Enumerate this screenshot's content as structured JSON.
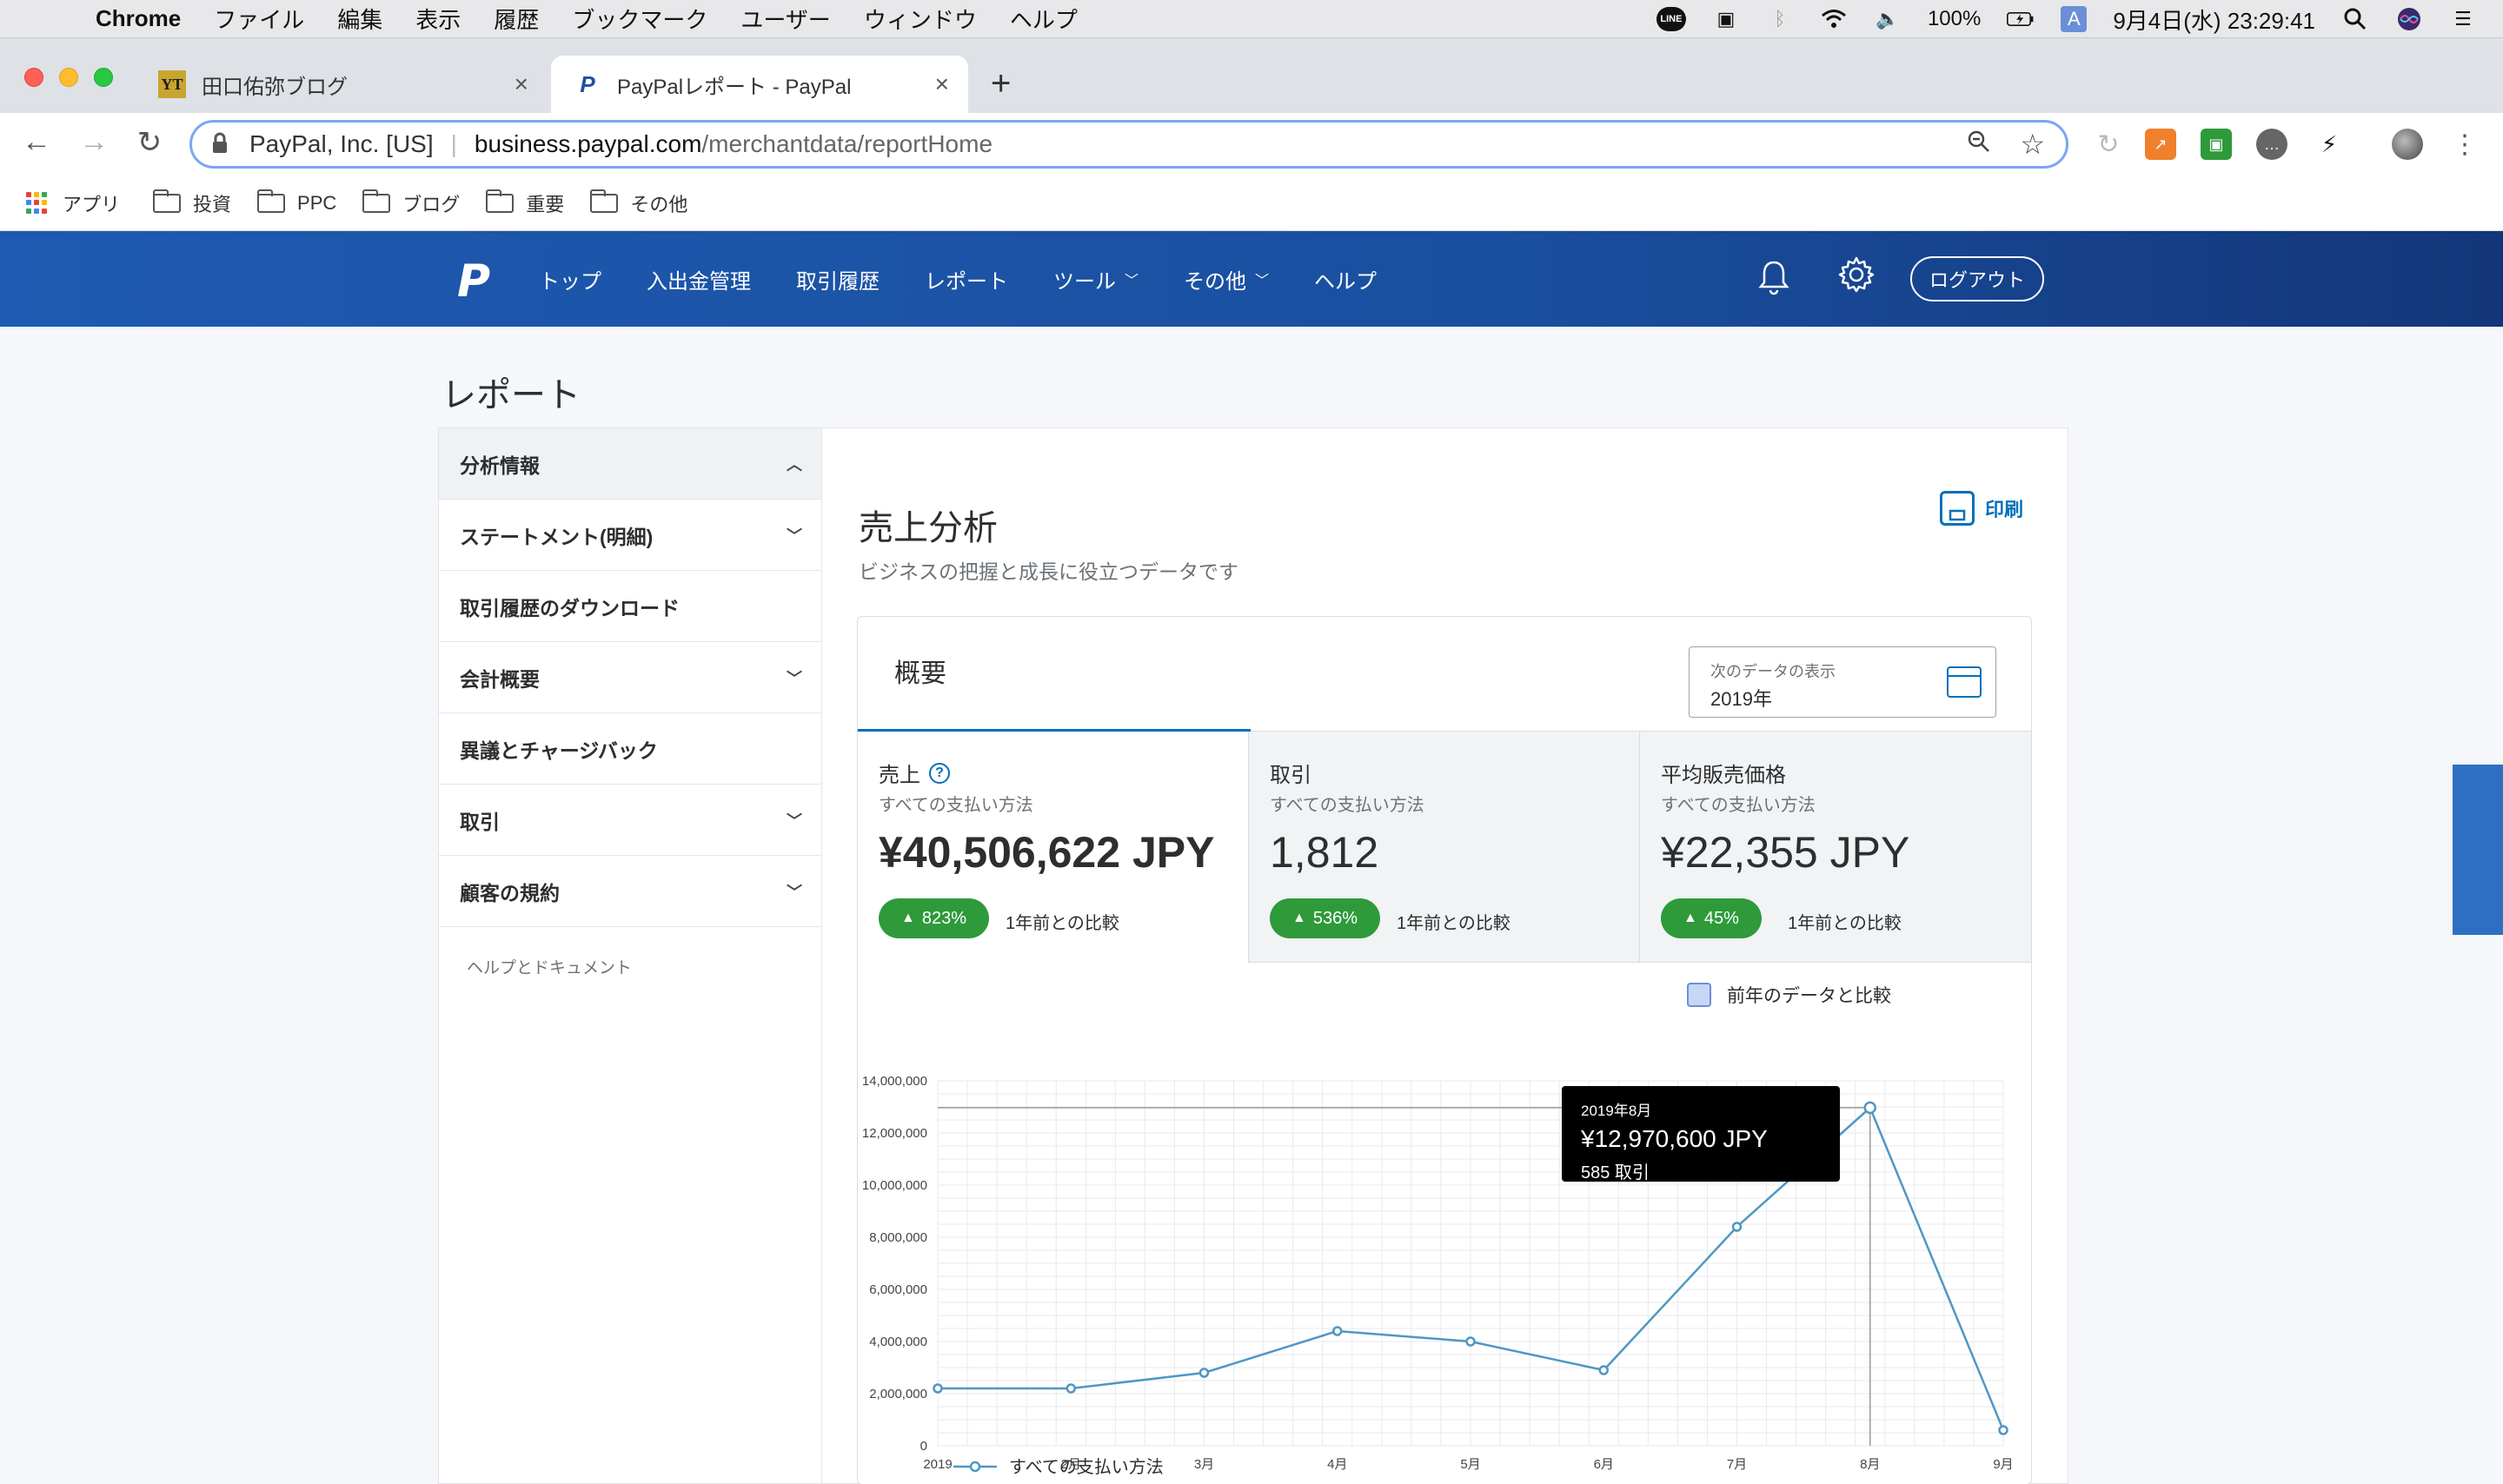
{
  "menubar": {
    "app": "Chrome",
    "items": [
      "ファイル",
      "編集",
      "表示",
      "履歴",
      "ブックマーク",
      "ユーザー",
      "ウィンドウ",
      "ヘルプ"
    ],
    "line_icon": "LINE",
    "battery": "100%",
    "input_method": "A",
    "clock": "9月4日(水)  23:29:41"
  },
  "tabs": [
    {
      "title": "田口佑弥ブログ",
      "favicon": "YT"
    },
    {
      "title": "PayPalレポート - PayPal",
      "favicon": "P"
    }
  ],
  "omnibox": {
    "org": "PayPal, Inc. [US]",
    "host": "business.paypal.com",
    "path": "/merchantdata/reportHome"
  },
  "bookmarks": [
    "アプリ",
    "投資",
    "PPC",
    "ブログ",
    "重要",
    "その他"
  ],
  "paypal_nav": {
    "logo": "P",
    "items": [
      "トップ",
      "入出金管理",
      "取引履歴",
      "レポート",
      "ツール",
      "その他",
      "ヘルプ"
    ],
    "logout": "ログアウト"
  },
  "page_title": "レポート",
  "sidebar": {
    "items": [
      "分析情報",
      "ステートメント(明細)",
      "取引履歴のダウンロード",
      "会計概要",
      "異議とチャージバック",
      "取引",
      "顧客の規約"
    ],
    "help": "ヘルプとドキュメント"
  },
  "main": {
    "title": "売上分析",
    "subtitle": "ビジネスの把握と成長に役立つデータです",
    "print": "印刷",
    "tab": "概要",
    "date_label": "次のデータの表示",
    "date_value": "2019年",
    "compare_label": "前年のデータと比較"
  },
  "kpis": [
    {
      "label": "売上",
      "help": "?",
      "sub": "すべての支払い方法",
      "value": "¥40,506,622 JPY",
      "change": "823%",
      "compare": "1年前との比較"
    },
    {
      "label": "取引",
      "sub": "すべての支払い方法",
      "value": "1,812",
      "change": "536%",
      "compare": "1年前との比較"
    },
    {
      "label": "平均販売価格",
      "sub": "すべての支払い方法",
      "value": "¥22,355 JPY",
      "change": "45%",
      "compare": "1年前との比較"
    }
  ],
  "tooltip": {
    "month": "2019年8月",
    "amount": "¥12,970,600 JPY",
    "count": "585 取引"
  },
  "chart_data": {
    "type": "line",
    "categories": [
      "2019",
      "2月",
      "3月",
      "4月",
      "5月",
      "6月",
      "7月",
      "8月",
      "9月"
    ],
    "series": [
      {
        "name": "すべての支払い方法",
        "values": [
          2200000,
          2200000,
          2800000,
          4400000,
          4000000,
          2900000,
          8400000,
          12970600,
          600000
        ],
        "color": "#4f97c3"
      }
    ],
    "yticks": [
      "0",
      "2,000,000",
      "4,000,000",
      "6,000,000",
      "8,000,000",
      "10,000,000",
      "12,000,000",
      "14,000,000"
    ],
    "ylim": [
      0,
      14000000
    ],
    "grid": true,
    "legend_position": "bottom-left"
  },
  "colors": {
    "paypal_blue": "#1e5ab1",
    "link_blue": "#0070ba",
    "badge_green": "#2e9a3a"
  }
}
